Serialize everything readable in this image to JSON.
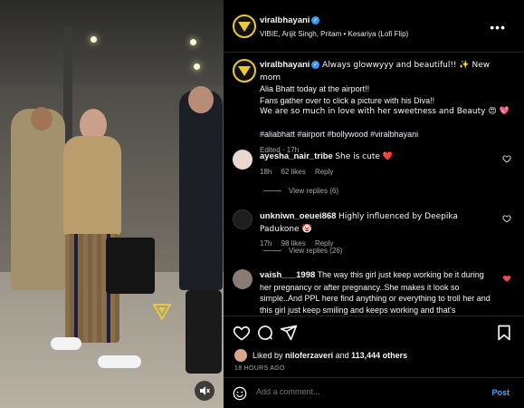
{
  "media": {
    "mute_icon": "speaker-muted-icon",
    "watermark_icon": "viral-bhayani-logo"
  },
  "header": {
    "username": "viralbhayani",
    "audio": "VIBIE, Arijit Singh, Pritam • Kesariya (Lofi Flip)",
    "more_label": "•••"
  },
  "caption": {
    "username": "viralbhayani",
    "line1": "Always glowwyyy and beautiful!! ✨ New mom",
    "line2": "Alia Bhatt today at the airport!!",
    "line3": "Fans gather over to click a picture with his Diva!!",
    "line4": "We are so much in love with her sweetness and Beauty 😍 💖",
    "hashtags": "#aliabhatt #airport #bollywood #viralbhayani",
    "time": "Edited · 17h"
  },
  "comments": [
    {
      "username": "ayesha_nair_tribe",
      "text": "She is cute ❤️",
      "time": "18h",
      "likes": "62 likes",
      "reply": "Reply",
      "view_replies": "View replies (6)",
      "liked": false
    },
    {
      "username": "unkniwn_oeuei868",
      "text": "Highly influenced by Deepika Padukone 🤡",
      "time": "17h",
      "likes": "98 likes",
      "reply": "Reply",
      "view_replies": "View replies (26)",
      "liked": false
    },
    {
      "username": "vaish___1998",
      "text": "The way this girl just keep working be it during her pregnancy or after pregnancy..She makes it look so simple..And PPL here find anything or everything to troll her and this girl just keep smiling and keeps working and that's",
      "liked": true
    }
  ],
  "actions": {
    "liked_by_prefix": "Liked by",
    "liked_by_user": "niloferzaveri",
    "liked_by_and": "and",
    "liked_by_count": "113,444 others",
    "date": "18 HOURS AGO"
  },
  "add_comment": {
    "placeholder": "Add a comment...",
    "post_label": "Post"
  },
  "colors": {
    "accent_blue": "#4aa7ff",
    "heart_red": "#ed4956",
    "logo_yellow": "#e9c83a"
  }
}
